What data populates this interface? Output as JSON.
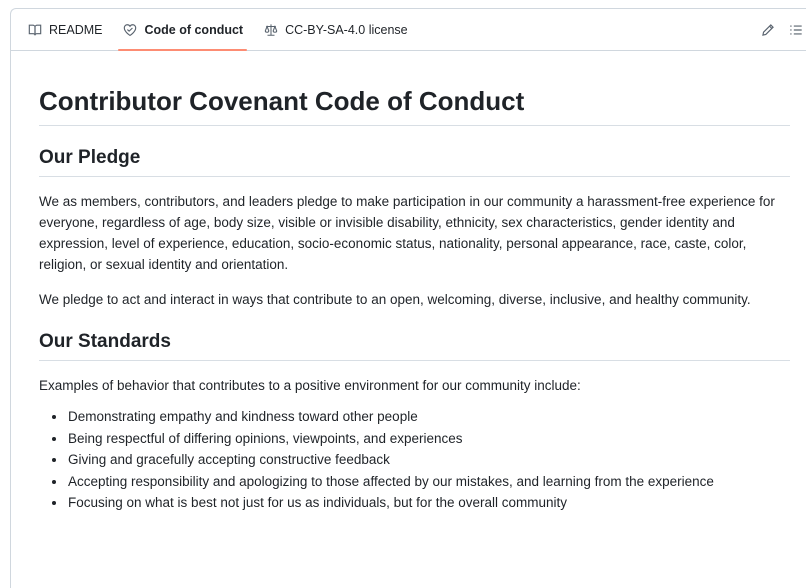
{
  "tabs": [
    {
      "label": "README",
      "icon": "book-icon",
      "active": false
    },
    {
      "label": "Code of conduct",
      "icon": "heart-handshake-icon",
      "active": true
    },
    {
      "label": "CC-BY-SA-4.0 license",
      "icon": "law-scale-icon",
      "active": false
    }
  ],
  "actions": {
    "edit_icon": "pencil-icon",
    "outline_icon": "list-outline-icon"
  },
  "doc": {
    "title": "Contributor Covenant Code of Conduct",
    "pledge": {
      "heading": "Our Pledge",
      "p1": "We as members, contributors, and leaders pledge to make participation in our community a harassment-free experience for everyone, regardless of age, body size, visible or invisible disability, ethnicity, sex characteristics, gender identity and expression, level of experience, education, socio-economic status, nationality, personal appearance, race, caste, color, religion, or sexual identity and orientation.",
      "p2": "We pledge to act and interact in ways that contribute to an open, welcoming, diverse, inclusive, and healthy community."
    },
    "standards": {
      "heading": "Our Standards",
      "intro": "Examples of behavior that contributes to a positive environment for our community include:",
      "items": [
        "Demonstrating empathy and kindness toward other people",
        "Being respectful of differing opinions, viewpoints, and experiences",
        "Giving and gracefully accepting constructive feedback",
        "Accepting responsibility and apologizing to those affected by our mistakes, and learning from the experience",
        "Focusing on what is best not just for us as individuals, but for the overall community"
      ]
    }
  },
  "colors": {
    "active_tab_underline": "#fd8c73",
    "border": "#d0d7de",
    "text": "#1f2328",
    "muted": "#59636e"
  }
}
